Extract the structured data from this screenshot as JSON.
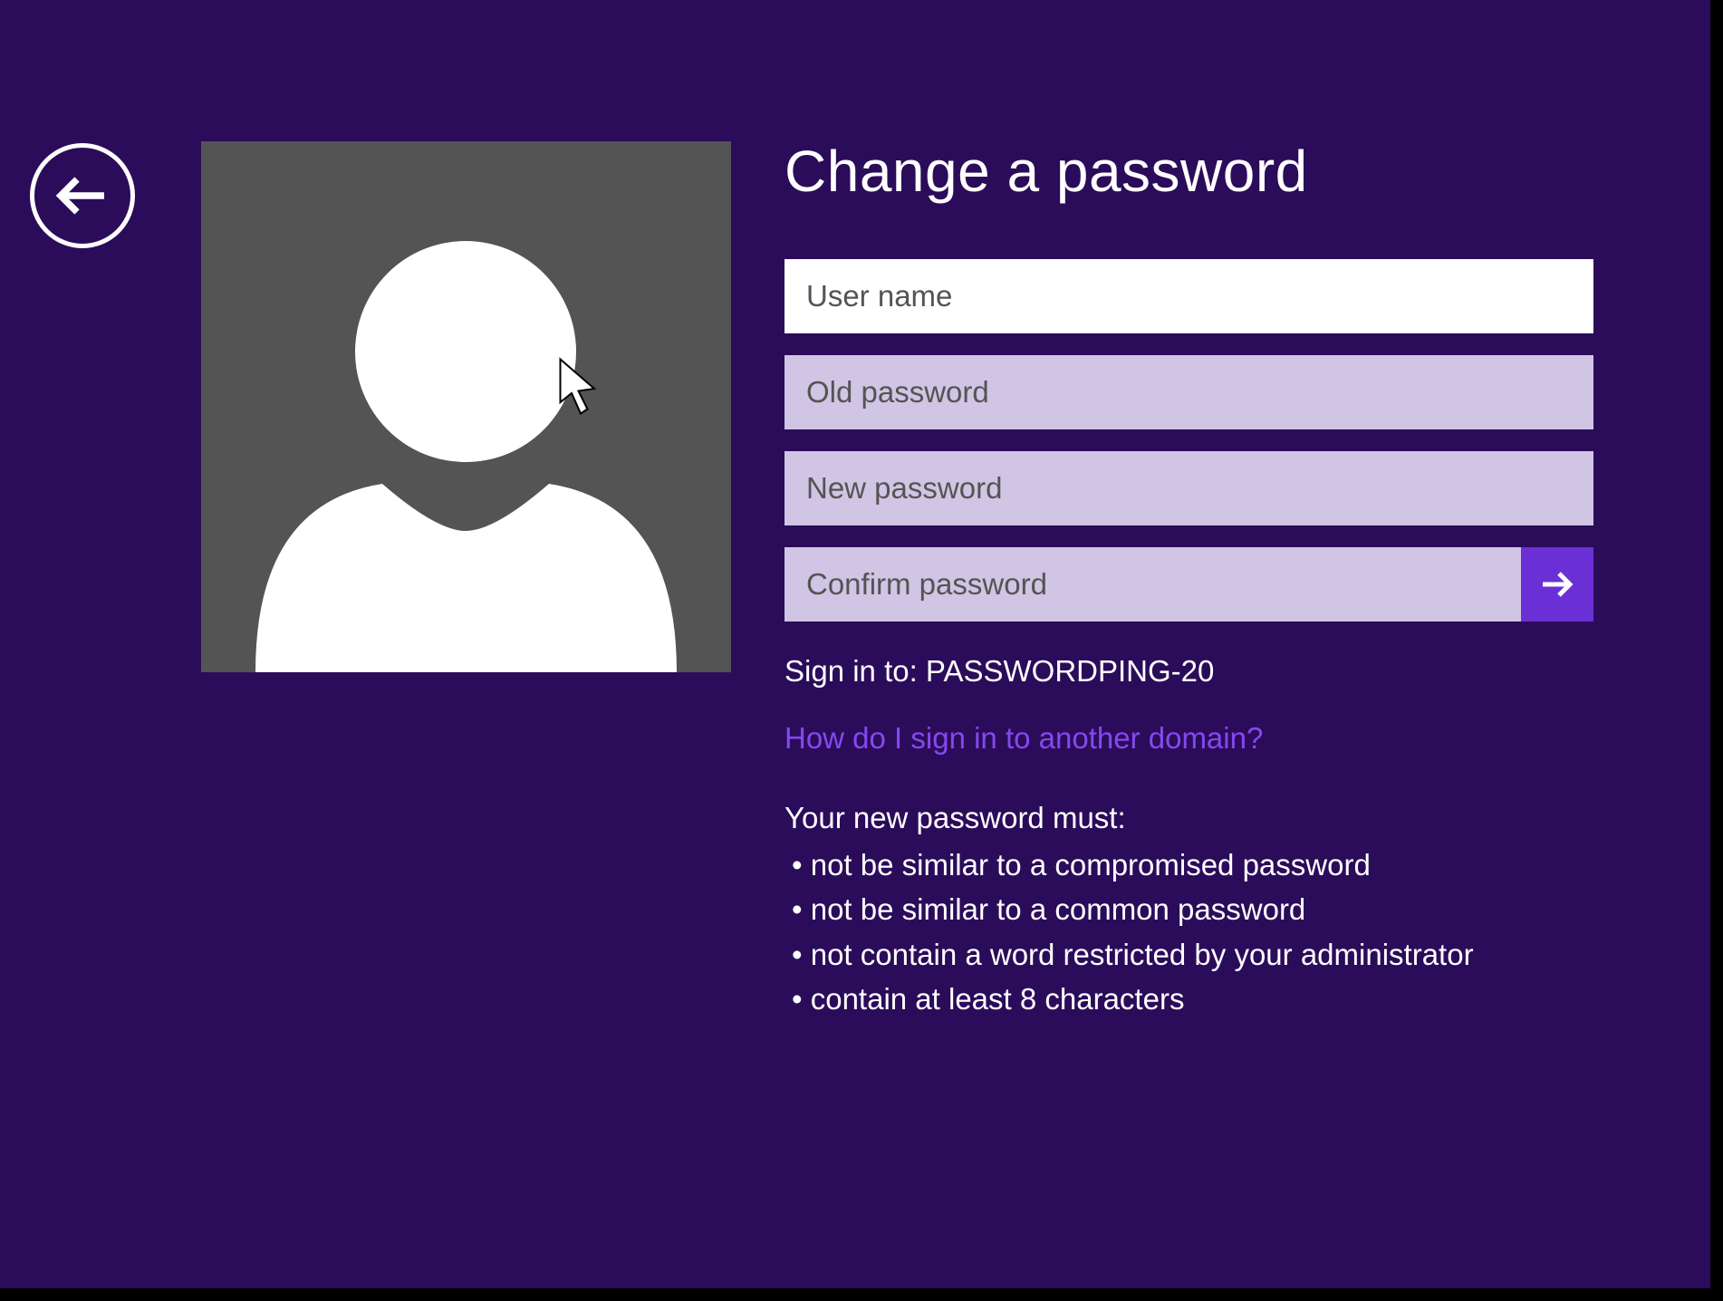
{
  "title": "Change a password",
  "fields": {
    "username": {
      "placeholder": "User name",
      "value": ""
    },
    "old_password": {
      "placeholder": "Old password",
      "value": ""
    },
    "new_password": {
      "placeholder": "New password",
      "value": ""
    },
    "confirm_password": {
      "placeholder": "Confirm password",
      "value": ""
    }
  },
  "sign_in_to": "Sign in to: PASSWORDPING-20",
  "help_link": "How do I sign in to another domain?",
  "requirements": {
    "heading": "Your new password must:",
    "items": [
      "• not be similar to a compromised password",
      "• not be similar to a common password",
      "• not contain a word restricted by your administrator",
      "• contain at least 8 characters"
    ]
  },
  "colors": {
    "background": "#2b0c5a",
    "accent": "#6b2fd6",
    "link": "#8548f0",
    "inactive_field": "#d0c5e4"
  }
}
